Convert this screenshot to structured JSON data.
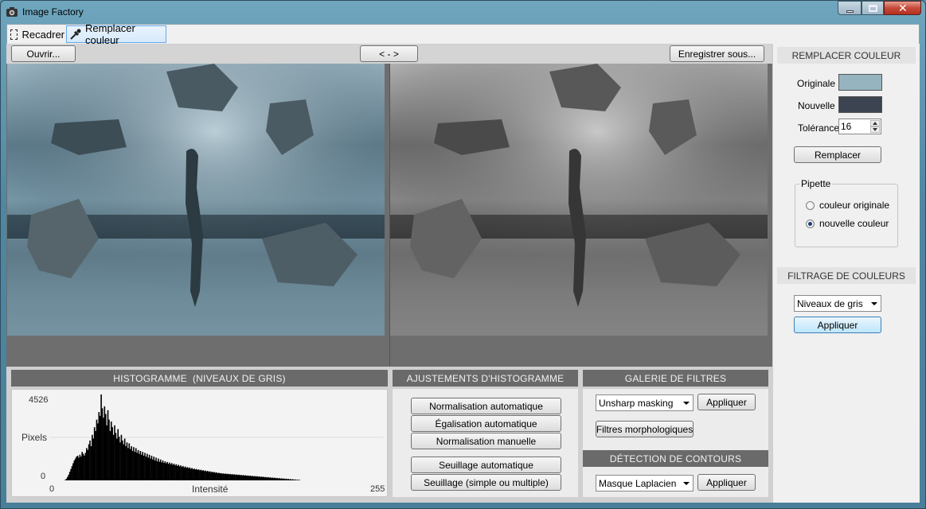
{
  "window": {
    "title": "Image Factory"
  },
  "tools": [
    {
      "label": "Recadrer",
      "icon": "dashed-selection-icon"
    },
    {
      "label": "Remplacer couleur",
      "icon": "eyedropper-icon"
    }
  ],
  "topbar": {
    "open_label": "Ouvrir...",
    "swap_label": "< - >",
    "save_label": "Enregistrer sous..."
  },
  "histogram": {
    "title": "HISTOGRAMME  (NIVEAUX DE GRIS)",
    "ymax_label": "4526",
    "ylabel": "Pixels",
    "ymin_label": "0",
    "xmin_label": "0",
    "xlabel": "Intensité",
    "xmax_label": "255"
  },
  "chart_data": {
    "type": "bar",
    "title": "HISTOGRAMME  (NIVEAUX DE GRIS)",
    "xlabel": "Intensité",
    "ylabel": "Pixels",
    "xlim": [
      0,
      255
    ],
    "ylim": [
      0,
      4526
    ],
    "values": [
      0,
      0,
      0,
      0,
      0,
      0,
      0,
      0,
      30,
      90,
      180,
      300,
      450,
      600,
      750,
      900,
      1050,
      1150,
      1250,
      1300,
      1200,
      1350,
      1250,
      1500,
      1400,
      1300,
      1450,
      1700,
      1600,
      1900,
      2100,
      1800,
      2400,
      2200,
      2800,
      2600,
      3200,
      3000,
      3600,
      3400,
      4526,
      3800,
      3300,
      3900,
      3500,
      2900,
      3700,
      3200,
      2600,
      3100,
      2800,
      2400,
      2900,
      2500,
      2200,
      2700,
      2300,
      2000,
      2400,
      2100,
      1900,
      2200,
      1800,
      2000,
      1700,
      1950,
      1650,
      1800,
      1550,
      1750,
      1500,
      1700,
      1450,
      1600,
      1400,
      1550,
      1350,
      1500,
      1300,
      1450,
      1250,
      1400,
      1200,
      1350,
      1150,
      1300,
      1100,
      1250,
      1050,
      1200,
      1000,
      1150,
      980,
      1100,
      950,
      1050,
      920,
      1000,
      900,
      970,
      870,
      940,
      850,
      910,
      820,
      880,
      790,
      850,
      760,
      820,
      740,
      790,
      710,
      760,
      680,
      730,
      660,
      700,
      640,
      680,
      610,
      650,
      590,
      620,
      570,
      600,
      550,
      580,
      530,
      560,
      510,
      540,
      490,
      520,
      470,
      500,
      450,
      480,
      430,
      460,
      420,
      440,
      400,
      420,
      380,
      400,
      370,
      380,
      350,
      370,
      340,
      360,
      330,
      350,
      320,
      340,
      310,
      330,
      300,
      320,
      290,
      310,
      280,
      300,
      270,
      290,
      260,
      280,
      250,
      270,
      240,
      260,
      230,
      250,
      220,
      240,
      210,
      230,
      200,
      220,
      190,
      210,
      180,
      200,
      170,
      190,
      160,
      180,
      150,
      170,
      140,
      160,
      130,
      150,
      120,
      140,
      110,
      130,
      100,
      120,
      90,
      110,
      80,
      100,
      70,
      90,
      60,
      80,
      50,
      70,
      40,
      60,
      30,
      50,
      20,
      40,
      10,
      30,
      0,
      0,
      0,
      0,
      0,
      0,
      0,
      0,
      0,
      0,
      0,
      0,
      0,
      0,
      0,
      0,
      0,
      0,
      0,
      0,
      0,
      0,
      0,
      0,
      0,
      0,
      0,
      0,
      0,
      0,
      0,
      0,
      0,
      0,
      0,
      0,
      0,
      0,
      0,
      0,
      0,
      0,
      0,
      0,
      0,
      0,
      0,
      0,
      0,
      0,
      0,
      0
    ]
  },
  "adjust": {
    "title": "AJUSTEMENTS D'HISTOGRAMME",
    "buttons": [
      "Normalisation automatique",
      "Égalisation automatique",
      "Normalisation manuelle",
      "Seuillage automatique",
      "Seuillage (simple ou multiple)"
    ]
  },
  "gallery": {
    "title": "GALERIE DE FILTRES",
    "filter_value": "Unsharp masking",
    "apply_label": "Appliquer",
    "morph_label": "Filtres morphologiques"
  },
  "edges": {
    "title": "DÉTECTION DE CONTOURS",
    "value": "Masque Laplacien",
    "apply_label": "Appliquer"
  },
  "replace": {
    "title": "REMPLACER COULEUR",
    "original_label": "Originale",
    "original_color": "#96b4c0",
    "new_label": "Nouvelle",
    "new_color": "#3b4450",
    "tolerance_label": "Tolérance",
    "tolerance_value": "16",
    "replace_label": "Remplacer",
    "pipette_label": "Pipette",
    "radio_original": "couleur originale",
    "radio_new": "nouvelle couleur"
  },
  "filtering": {
    "title": "FILTRAGE DE COULEURS",
    "value": "Niveaux de gris",
    "apply_label": "Appliquer"
  }
}
